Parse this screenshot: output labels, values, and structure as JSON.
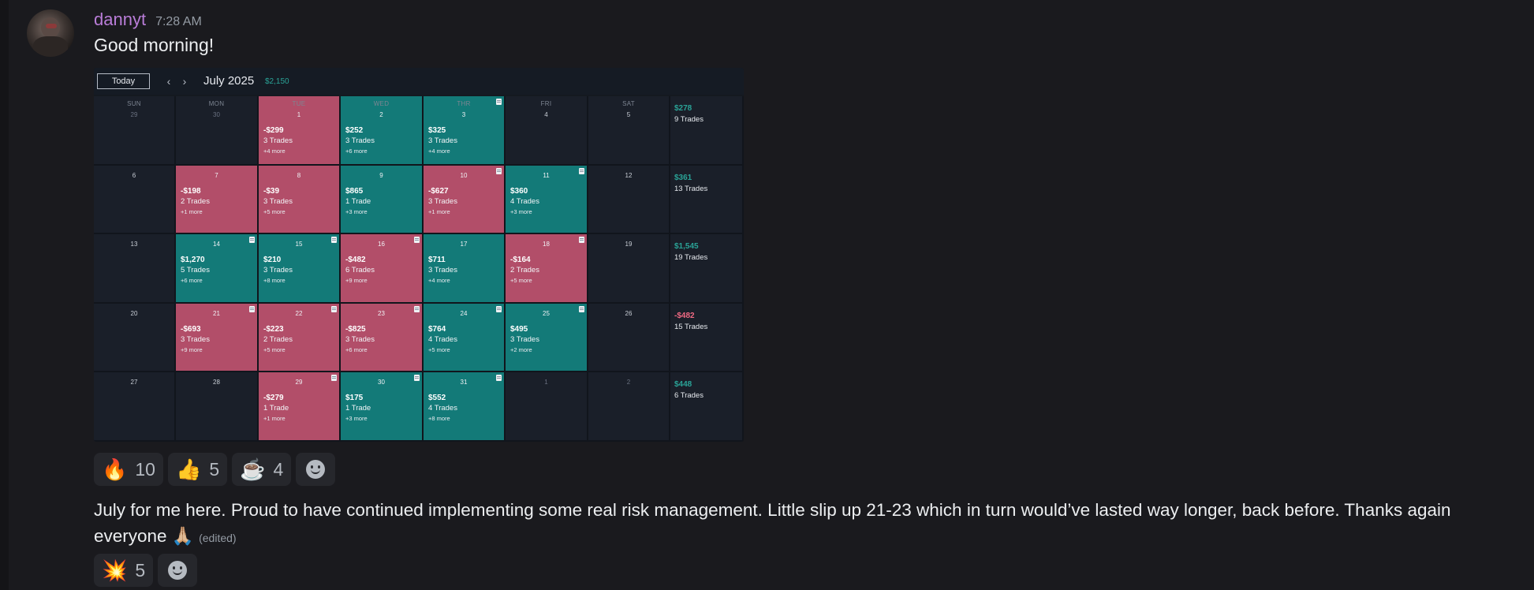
{
  "message": {
    "username": "dannyt",
    "timestamp": "7:28 AM",
    "text": "Good morning!",
    "reactions": [
      {
        "emoji": "🔥",
        "count": "10"
      },
      {
        "emoji": "👍",
        "count": "5"
      },
      {
        "emoji": "☕",
        "count": "4"
      }
    ]
  },
  "calendar": {
    "today_label": "Today",
    "prev_icon": "‹",
    "next_icon": "›",
    "month": "July 2025",
    "month_total": "$2,150",
    "weekdays": [
      "SUN",
      "MON",
      "TUE",
      "WED",
      "THR",
      "FRI",
      "SAT"
    ],
    "weeks": [
      {
        "days": [
          {
            "day": "29",
            "dim": true
          },
          {
            "day": "30",
            "dim": true
          },
          {
            "day": "1",
            "amount": "-$299",
            "trades": "3 Trades",
            "more": "+4 more",
            "status": "neg"
          },
          {
            "day": "2",
            "amount": "$252",
            "trades": "3 Trades",
            "more": "+6 more",
            "status": "pos"
          },
          {
            "day": "3",
            "amount": "$325",
            "trades": "3 Trades",
            "more": "+4 more",
            "status": "pos",
            "note": true
          },
          {
            "day": "4"
          },
          {
            "day": "5"
          }
        ],
        "summary": {
          "amount": "$278",
          "trades": "9 Trades",
          "status": "pos"
        }
      },
      {
        "days": [
          {
            "day": "6"
          },
          {
            "day": "7",
            "amount": "-$198",
            "trades": "2 Trades",
            "more": "+1 more",
            "status": "neg"
          },
          {
            "day": "8",
            "amount": "-$39",
            "trades": "3 Trades",
            "more": "+5 more",
            "status": "neg"
          },
          {
            "day": "9",
            "amount": "$865",
            "trades": "1 Trade",
            "more": "+3 more",
            "status": "pos"
          },
          {
            "day": "10",
            "amount": "-$627",
            "trades": "3 Trades",
            "more": "+1 more",
            "status": "neg",
            "note": true
          },
          {
            "day": "11",
            "amount": "$360",
            "trades": "4 Trades",
            "more": "+3 more",
            "status": "pos",
            "note": true
          },
          {
            "day": "12"
          }
        ],
        "summary": {
          "amount": "$361",
          "trades": "13 Trades",
          "status": "pos"
        }
      },
      {
        "days": [
          {
            "day": "13"
          },
          {
            "day": "14",
            "amount": "$1,270",
            "trades": "5 Trades",
            "more": "+6 more",
            "status": "pos",
            "note": true
          },
          {
            "day": "15",
            "amount": "$210",
            "trades": "3 Trades",
            "more": "+8 more",
            "status": "pos",
            "note": true
          },
          {
            "day": "16",
            "amount": "-$482",
            "trades": "6 Trades",
            "more": "+9 more",
            "status": "neg",
            "note": true
          },
          {
            "day": "17",
            "amount": "$711",
            "trades": "3 Trades",
            "more": "+4 more",
            "status": "pos"
          },
          {
            "day": "18",
            "amount": "-$164",
            "trades": "2 Trades",
            "more": "+5 more",
            "status": "neg",
            "note": true
          },
          {
            "day": "19"
          }
        ],
        "summary": {
          "amount": "$1,545",
          "trades": "19 Trades",
          "status": "pos"
        }
      },
      {
        "days": [
          {
            "day": "20"
          },
          {
            "day": "21",
            "amount": "-$693",
            "trades": "3 Trades",
            "more": "+9 more",
            "status": "neg",
            "note": true
          },
          {
            "day": "22",
            "amount": "-$223",
            "trades": "2 Trades",
            "more": "+5 more",
            "status": "neg",
            "note": true
          },
          {
            "day": "23",
            "amount": "-$825",
            "trades": "3 Trades",
            "more": "+6 more",
            "status": "neg",
            "note": true
          },
          {
            "day": "24",
            "amount": "$764",
            "trades": "4 Trades",
            "more": "+5 more",
            "status": "pos",
            "note": true
          },
          {
            "day": "25",
            "amount": "$495",
            "trades": "3 Trades",
            "more": "+2 more",
            "status": "pos",
            "note": true
          },
          {
            "day": "26"
          }
        ],
        "summary": {
          "amount": "-$482",
          "trades": "15 Trades",
          "status": "neg"
        }
      },
      {
        "days": [
          {
            "day": "27"
          },
          {
            "day": "28"
          },
          {
            "day": "29",
            "amount": "-$279",
            "trades": "1 Trade",
            "more": "+1 more",
            "status": "neg",
            "note": true
          },
          {
            "day": "30",
            "amount": "$175",
            "trades": "1 Trade",
            "more": "+3 more",
            "status": "pos",
            "note": true
          },
          {
            "day": "31",
            "amount": "$552",
            "trades": "4 Trades",
            "more": "+8 more",
            "status": "pos",
            "note": true
          },
          {
            "day": "1",
            "dim": true
          },
          {
            "day": "2",
            "dim": true
          }
        ],
        "summary": {
          "amount": "$448",
          "trades": "6 Trades",
          "status": "pos"
        }
      }
    ]
  },
  "message2": {
    "text": "July for me here. Proud to have continued implementing some real risk management. Little slip up 21-23 which in turn would’ve lasted way longer, back before. Thanks again everyone",
    "emoji": "🙏🏼",
    "edited_label": "(edited)",
    "reactions": [
      {
        "emoji": "💥",
        "count": "5"
      }
    ]
  },
  "colors": {
    "positive": "#137a78",
    "negative": "#b24e69",
    "positive_text": "#2aa397",
    "negative_text": "#f06a83",
    "username": "#b97dd8"
  },
  "icons": {
    "add_reaction": "add-reaction-smile-icon",
    "note": "note-icon"
  }
}
